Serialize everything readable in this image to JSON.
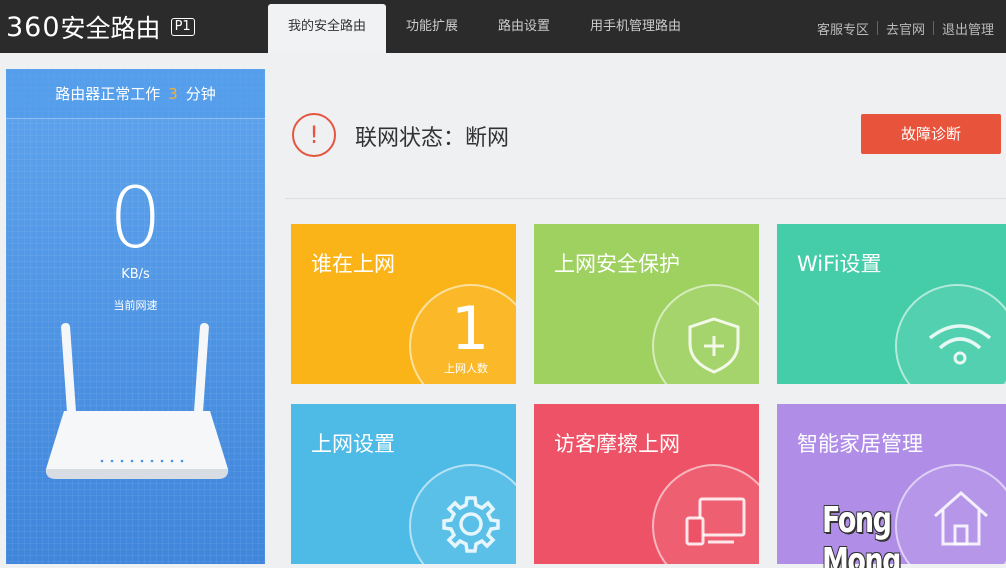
{
  "header": {
    "logo_num": "360",
    "logo_text": "安全路由",
    "logo_model": "P1",
    "tabs": [
      {
        "label": "我的安全路由",
        "active": true
      },
      {
        "label": "功能扩展",
        "active": false
      },
      {
        "label": "路由设置",
        "active": false
      },
      {
        "label": "用手机管理路由",
        "active": false
      }
    ],
    "links": [
      "客服专区",
      "去官网",
      "退出管理"
    ]
  },
  "sidebar": {
    "uptime_prefix": "路由器正常工作",
    "uptime_value": "3",
    "uptime_suffix": "分钟",
    "speed_value": "0",
    "speed_unit": "KB/s",
    "speed_label": "当前网速"
  },
  "status": {
    "icon": "!",
    "text": "联网状态：断网",
    "diag_button": "故障诊断"
  },
  "tiles": [
    {
      "title": "谁在上网",
      "count": "1",
      "count_label": "上网人数",
      "icon": "none",
      "color": "#fbb417"
    },
    {
      "title": "上网安全保护",
      "icon": "shield-plus-icon",
      "color": "#9ed160"
    },
    {
      "title": "WiFi设置",
      "icon": "wifi-icon",
      "color": "#45cda9"
    },
    {
      "title": "上网设置",
      "icon": "gear-icon",
      "color": "#4ebbe6"
    },
    {
      "title": "访客摩擦上网",
      "icon": "devices-icon",
      "color": "#ee5266"
    },
    {
      "title": "智能家居管理",
      "icon": "home-icon",
      "color": "#b08ee8"
    }
  ],
  "watermark": "Fong Mong"
}
